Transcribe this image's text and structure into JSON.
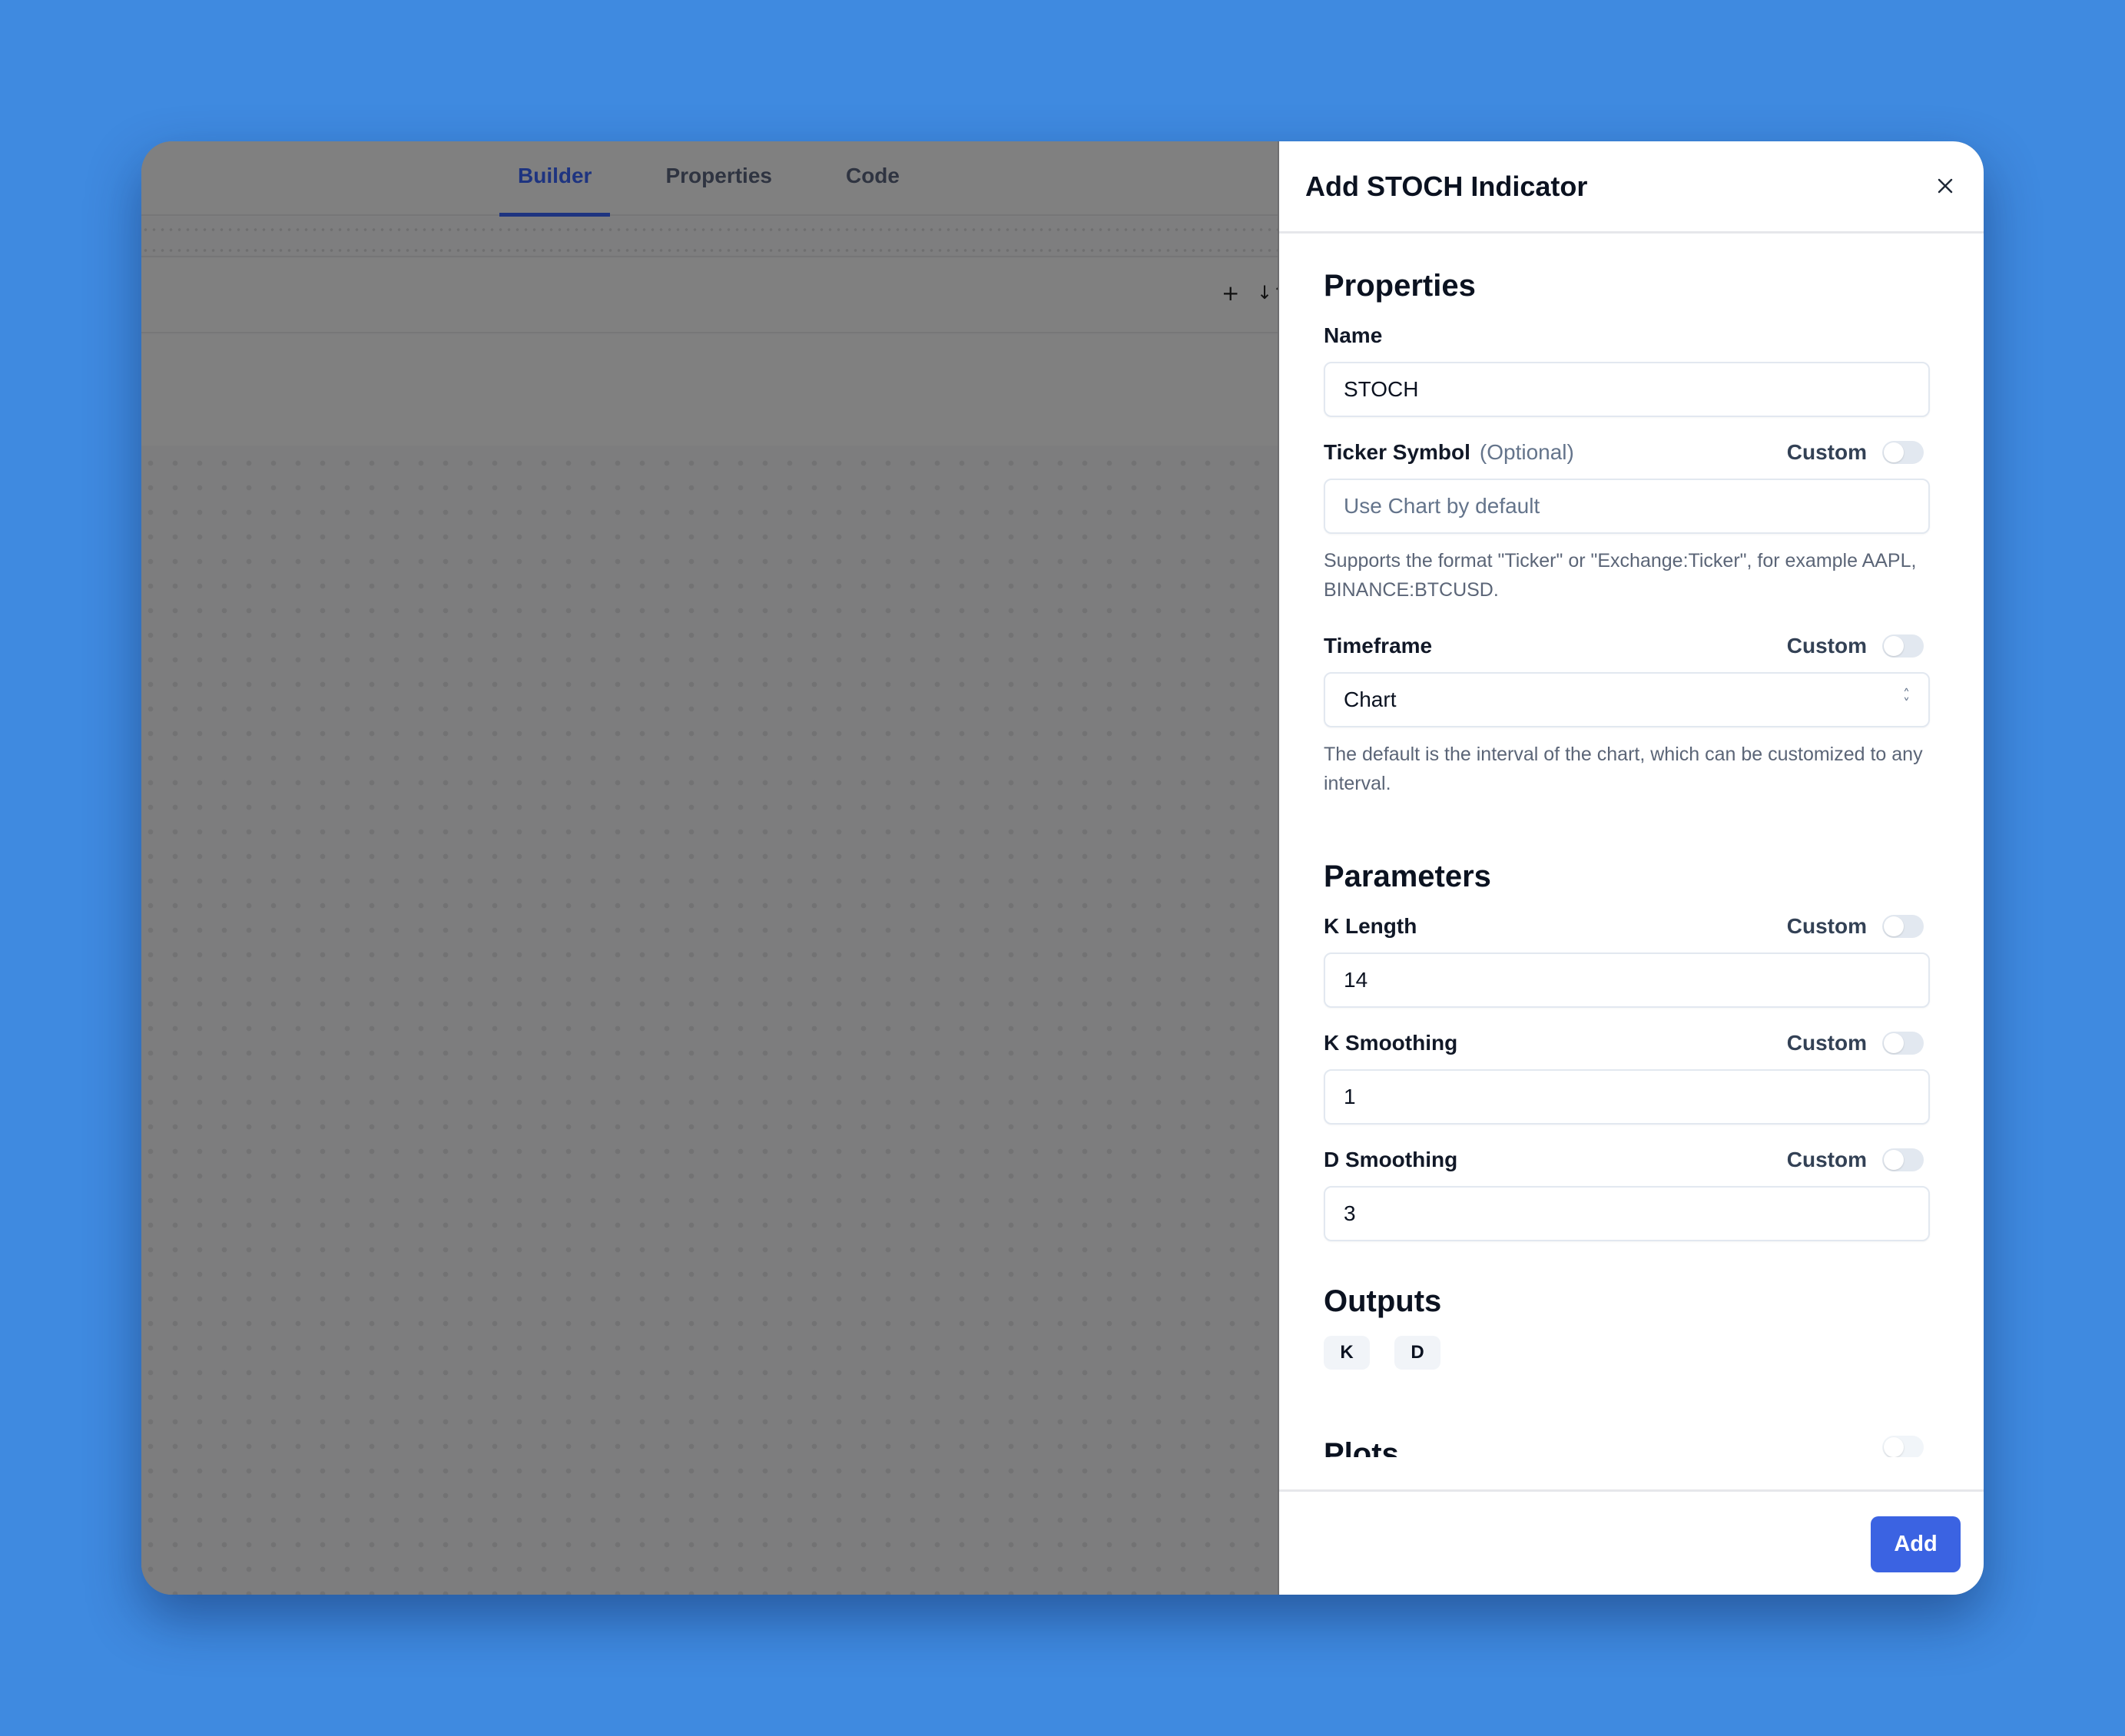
{
  "app": {
    "tabs": [
      {
        "label": "Builder",
        "active": true
      },
      {
        "label": "Properties",
        "active": false
      },
      {
        "label": "Code",
        "active": false
      }
    ],
    "toolbar": {
      "add_icon": "plus-icon",
      "sort_icon": "sort-arrows-icon"
    }
  },
  "modal": {
    "title": "Add STOCH Indicator",
    "close_icon": "close-icon",
    "sections": {
      "properties": {
        "title": "Properties",
        "name": {
          "label": "Name",
          "value": "STOCH"
        },
        "ticker": {
          "label": "Ticker Symbol",
          "optional": "(Optional)",
          "custom_label": "Custom",
          "custom_enabled": false,
          "value": "",
          "placeholder": "Use Chart by default",
          "help": "Supports the format \"Ticker\" or \"Exchange:Ticker\", for example AAPL, BINANCE:BTCUSD."
        },
        "timeframe": {
          "label": "Timeframe",
          "custom_label": "Custom",
          "custom_enabled": false,
          "selected": "Chart",
          "help": "The default is the interval of the chart, which can be customized to any interval."
        }
      },
      "parameters": {
        "title": "Parameters",
        "fields": [
          {
            "label": "K Length",
            "custom_label": "Custom",
            "custom_enabled": false,
            "value": "14"
          },
          {
            "label": "K Smoothing",
            "custom_label": "Custom",
            "custom_enabled": false,
            "value": "1"
          },
          {
            "label": "D Smoothing",
            "custom_label": "Custom",
            "custom_enabled": false,
            "value": "3"
          }
        ]
      },
      "outputs": {
        "title": "Outputs",
        "items": [
          "K",
          "D"
        ]
      },
      "plots": {
        "title": "Plots",
        "enabled": false
      }
    },
    "footer": {
      "add_label": "Add"
    }
  },
  "colors": {
    "background": "#3f8ae0",
    "primary_button": "#3b63e2",
    "active_tab": "#1e3480"
  }
}
